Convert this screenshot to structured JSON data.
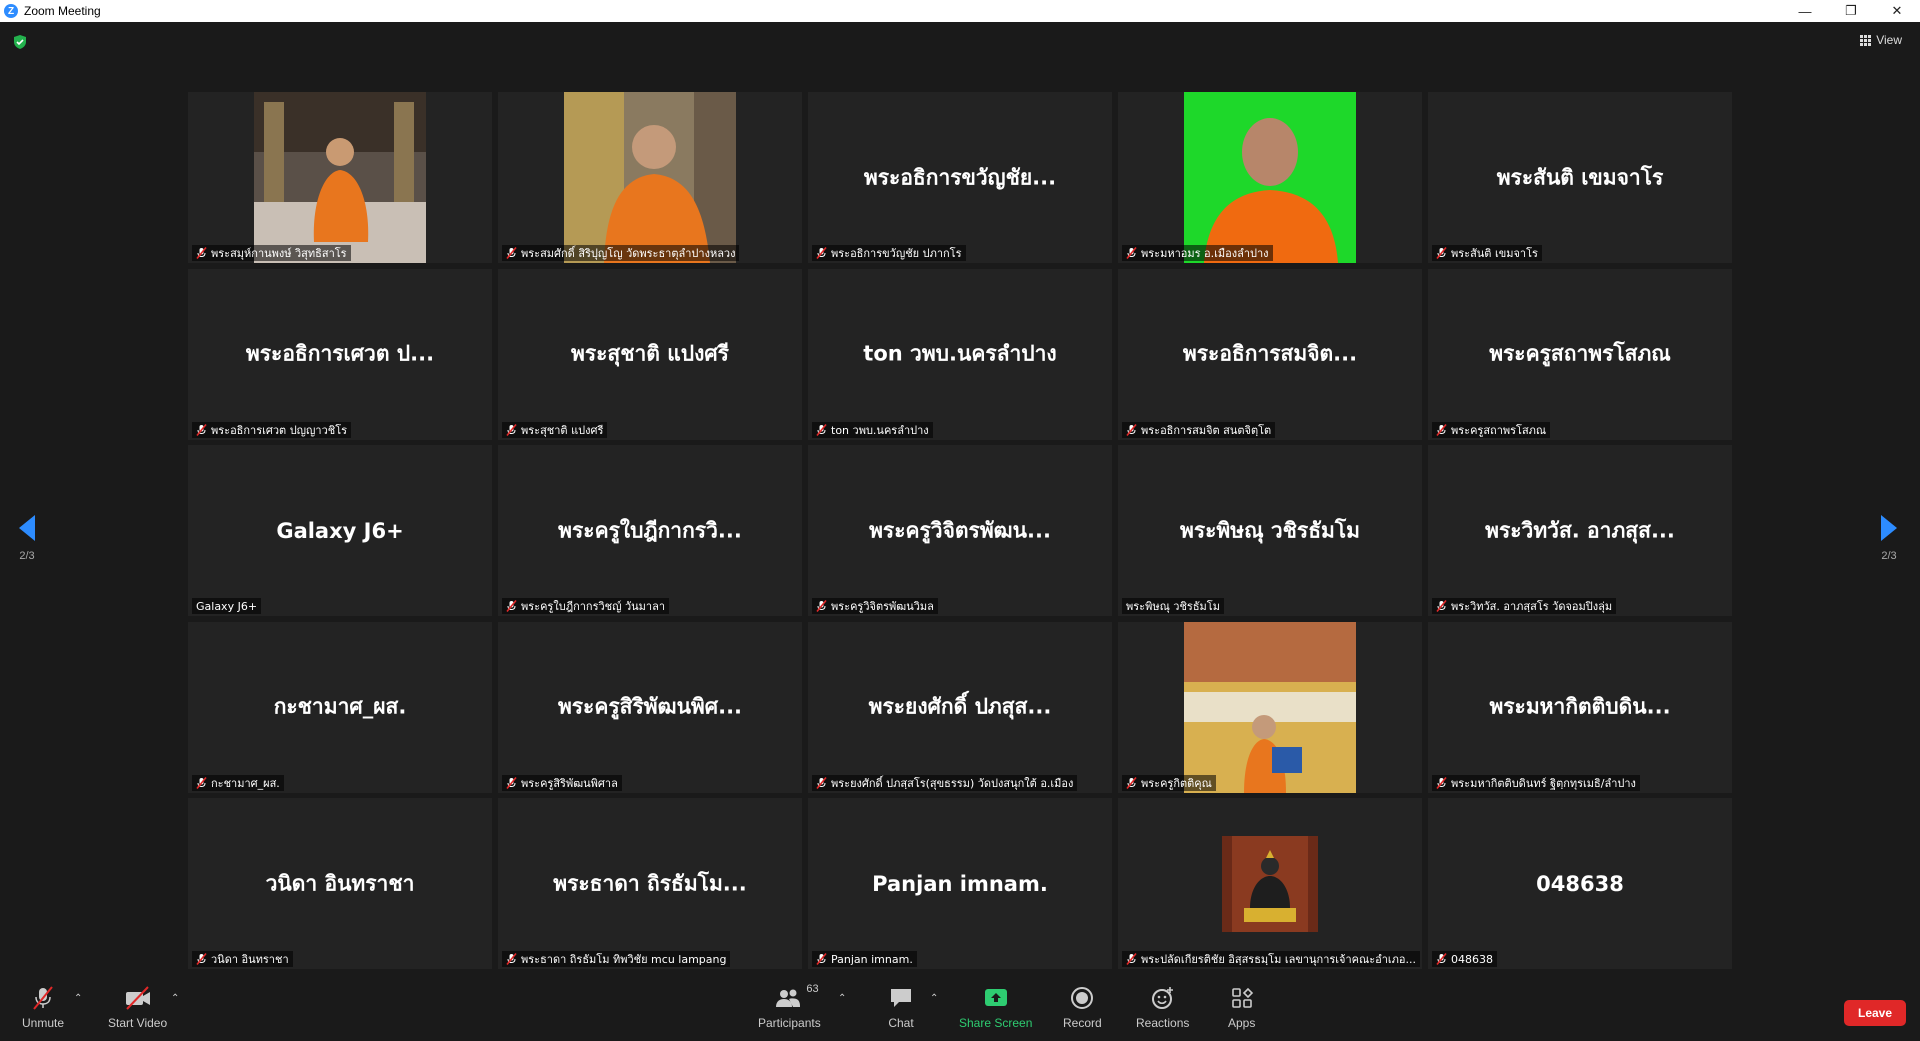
{
  "window": {
    "title": "Zoom Meeting"
  },
  "top": {
    "view_label": "View"
  },
  "pager": {
    "left_label": "2/3",
    "right_label": "2/3"
  },
  "tiles": [
    {
      "big": "",
      "tag": "พระสมุห์กานพงษ์ วิสุทธิสาโร",
      "muted": true,
      "photo": "monk-temple-1"
    },
    {
      "big": "",
      "tag": "พระสมศักดิ์ สิริปุญโญ วัดพระธาตุลำปางหลวง",
      "muted": true,
      "photo": "monk-temple-2"
    },
    {
      "big": "พระอธิการขวัญชัย...",
      "tag": "พระอธิการขวัญชัย ปภากโร",
      "muted": true
    },
    {
      "big": "",
      "tag": "พระมหาอมร อ.เมืองลำปาง",
      "muted": true,
      "photo": "monk-green"
    },
    {
      "big": "พระสันติ เขมจาโร",
      "tag": "พระสันติ เขมจาโร",
      "muted": true
    },
    {
      "big": "พระอธิการเศวต ป...",
      "tag": "พระอธิการเศวต ปญญาวชิโร",
      "muted": true
    },
    {
      "big": "พระสุชาติ แปงศรี",
      "tag": "พระสุชาติ แปงศรี",
      "muted": true
    },
    {
      "big": "ton วพบ.นครลำปาง",
      "tag": "ton วพบ.นครลำปาง",
      "muted": true
    },
    {
      "big": "พระอธิการสมจิต...",
      "tag": "พระอธิการสมจิต สนตจิตฺโต",
      "muted": true
    },
    {
      "big": "พระครูสถาพรโสภณ",
      "tag": "พระครูสถาพรโสภณ",
      "muted": true
    },
    {
      "big": "Galaxy J6+",
      "tag": "Galaxy J6+",
      "muted": false
    },
    {
      "big": "พระครูใบฎีกากรวิ...",
      "tag": "พระครูใบฎีกากรวิชญ์ วันมาลา",
      "muted": true
    },
    {
      "big": "พระครูวิจิตรพัฒน...",
      "tag": "พระครูวิจิตรพัฒนวิมล",
      "muted": true
    },
    {
      "big": "พระพิษณุ วชิรธัมโม",
      "tag": "พระพิษณุ วชิรธัมโม",
      "muted": false
    },
    {
      "big": "พระวิทวัส. อาภสุส...",
      "tag": "พระวิทวัส. อาภสฺสโร วัดจอมปิงลุ่ม",
      "muted": true
    },
    {
      "big": "กะชามาศ_ผส.",
      "tag": "กะชามาศ_ผส.",
      "muted": true
    },
    {
      "big": "พระครูสิริพัฒนพิศ...",
      "tag": "พระครูสิริพัฒนพิศาล",
      "muted": true
    },
    {
      "big": "พระยงศักดิ์ ปภสุส...",
      "tag": "พระยงศักดิ์ ปภสฺสโร(สุขธรรม) วัดปงสนุกใต้ อ.เมือง",
      "muted": true
    },
    {
      "big": "",
      "tag": "พระครูกิตติคุณ",
      "muted": true,
      "photo": "monk-certificate"
    },
    {
      "big": "พระมหากิตติบดิน...",
      "tag": "พระมหากิตติบดินทร์ ฐิตฺกทุรเมธิ/ลำปาง",
      "muted": true
    },
    {
      "big": "วนิดา  อินทราชา",
      "tag": "วนิดา  อินทราชา",
      "muted": true
    },
    {
      "big": "พระธาดา ถิรธัมโม...",
      "tag": "พระธาดา ถิรธัมโม ทิพวิชัย mcu lampang",
      "muted": true
    },
    {
      "big": "Panjan imnam.",
      "tag": "Panjan imnam.",
      "muted": true
    },
    {
      "big": "",
      "tag": "พระปลัดเกียรติชัย  อิสฺสรธมฺโม เลขานุการเจ้าคณะอำเภอ...",
      "muted": true,
      "photo": "buddha-statue"
    },
    {
      "big": "048638",
      "tag": "048638",
      "muted": true
    }
  ],
  "toolbar": {
    "unmute": "Unmute",
    "start_video": "Start Video",
    "participants": "Participants",
    "participants_count": "63",
    "chat": "Chat",
    "share_screen": "Share Screen",
    "record": "Record",
    "reactions": "Reactions",
    "apps": "Apps",
    "leave": "Leave"
  },
  "colors": {
    "accent": "#2D8CFF",
    "share": "#2ECC71",
    "leave": "#E02828",
    "muted_red": "#E02828"
  }
}
